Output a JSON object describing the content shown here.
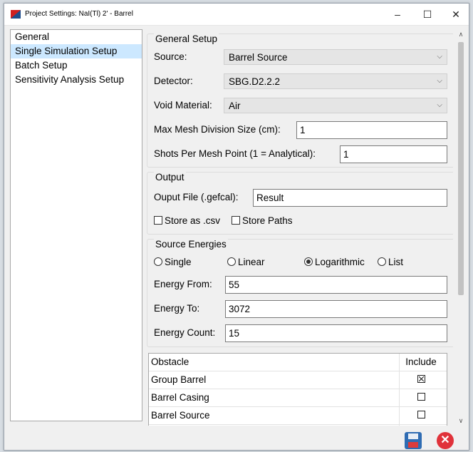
{
  "window": {
    "title": "Project Settings: NaI(Tl) 2' - Barrel",
    "minimize": "–",
    "maximize": "☐",
    "close": "✕"
  },
  "sidebar": {
    "items": [
      {
        "label": "General"
      },
      {
        "label": "Single Simulation Setup"
      },
      {
        "label": "Batch Setup"
      },
      {
        "label": "Sensitivity Analysis Setup"
      }
    ]
  },
  "general_setup": {
    "title": "General Setup",
    "source_label": "Source:",
    "source_value": "Barrel Source",
    "detector_label": "Detector:",
    "detector_value": "SBG.D2.2.2",
    "void_label": "Void Material:",
    "void_value": "Air",
    "mesh_label": "Max Mesh Division Size (cm):",
    "mesh_value": "1",
    "shots_label": "Shots Per Mesh Point (1 = Analytical):",
    "shots_value": "1"
  },
  "output": {
    "title": "Output",
    "file_label": "Ouput File (.gefcal):",
    "file_value": "Result",
    "csv_label": "Store as .csv",
    "paths_label": "Store Paths"
  },
  "source_energies": {
    "title": "Source Energies",
    "radio_single": "Single",
    "radio_linear": "Linear",
    "radio_log": "Logarithmic",
    "radio_list": "List",
    "from_label": "Energy From:",
    "from_value": "55",
    "to_label": "Energy To:",
    "to_value": "3072",
    "count_label": "Energy Count:",
    "count_value": "15"
  },
  "obstacles": {
    "header_name": "Obstacle",
    "header_include": "Include",
    "rows": [
      {
        "name": "Group Barrel",
        "include": true
      },
      {
        "name": "Barrel Casing",
        "include": false
      },
      {
        "name": "Barrel Source",
        "include": false
      }
    ]
  },
  "icons": {
    "chevron": "⌵",
    "scroll_up": "∧",
    "scroll_down": "∨",
    "close_x": "✕"
  },
  "colors": {
    "selection": "#cce8ff",
    "save": "#2f6cb3",
    "cancel": "#e0323a"
  }
}
